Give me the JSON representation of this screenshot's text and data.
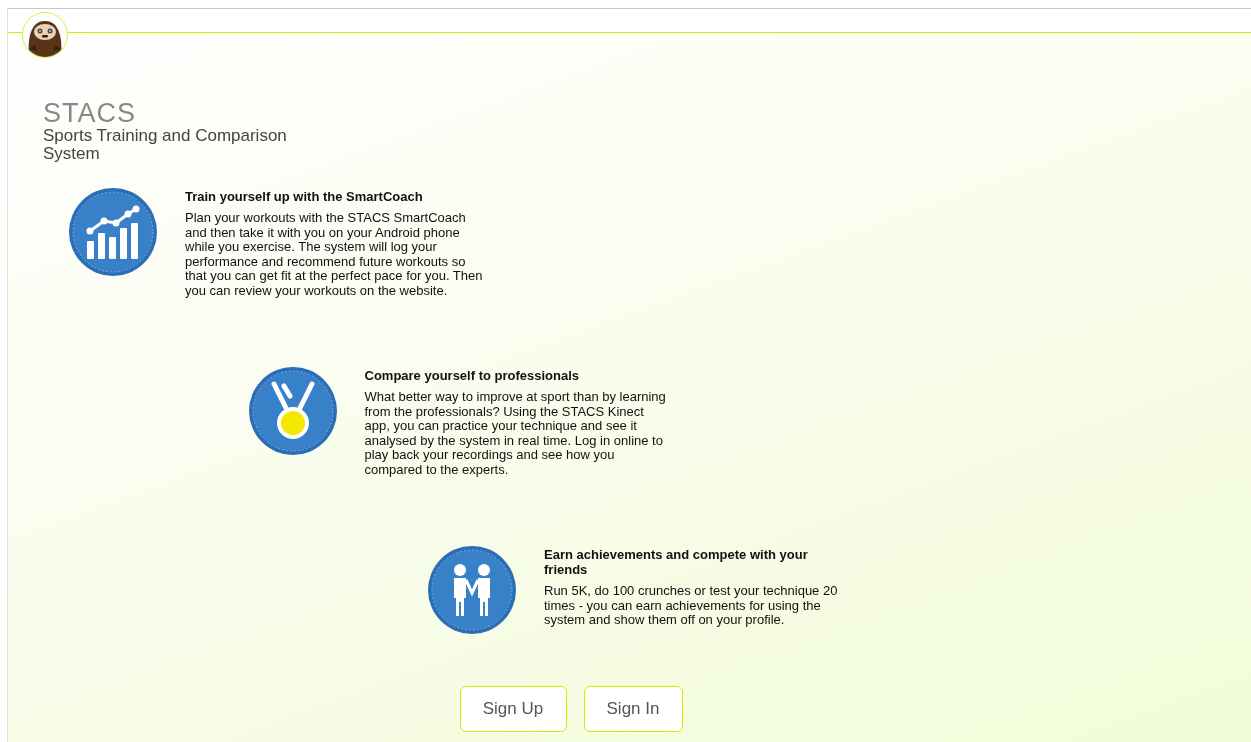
{
  "brand": {
    "title": "STACS",
    "subtitle": "Sports Training and Comparison System"
  },
  "features": [
    {
      "kind": "chart",
      "title": "Train yourself up with the SmartCoach",
      "body": "Plan your workouts with the STACS SmartCoach and then take it with you on your Android phone while you exercise. The system will log your performance and recommend future workouts so that you can get fit at the perfect pace for you. Then you can review your workouts on the website."
    },
    {
      "kind": "medal",
      "title": "Compare yourself to professionals",
      "body": "What better way to improve at sport than by learning from the professionals? Using the STACS Kinect app, you can practice your technique and see it analysed by the system in real time. Log in online to play back your recordings and see how you compared to the experts."
    },
    {
      "kind": "friends",
      "title": "Earn achievements and compete with your friends",
      "body": "Run 5K, do 100 crunches or test your technique 20 times - you can earn achievements for using the system and show them off on your profile."
    }
  ],
  "buttons": [
    "Sign Up",
    "Sign In"
  ]
}
